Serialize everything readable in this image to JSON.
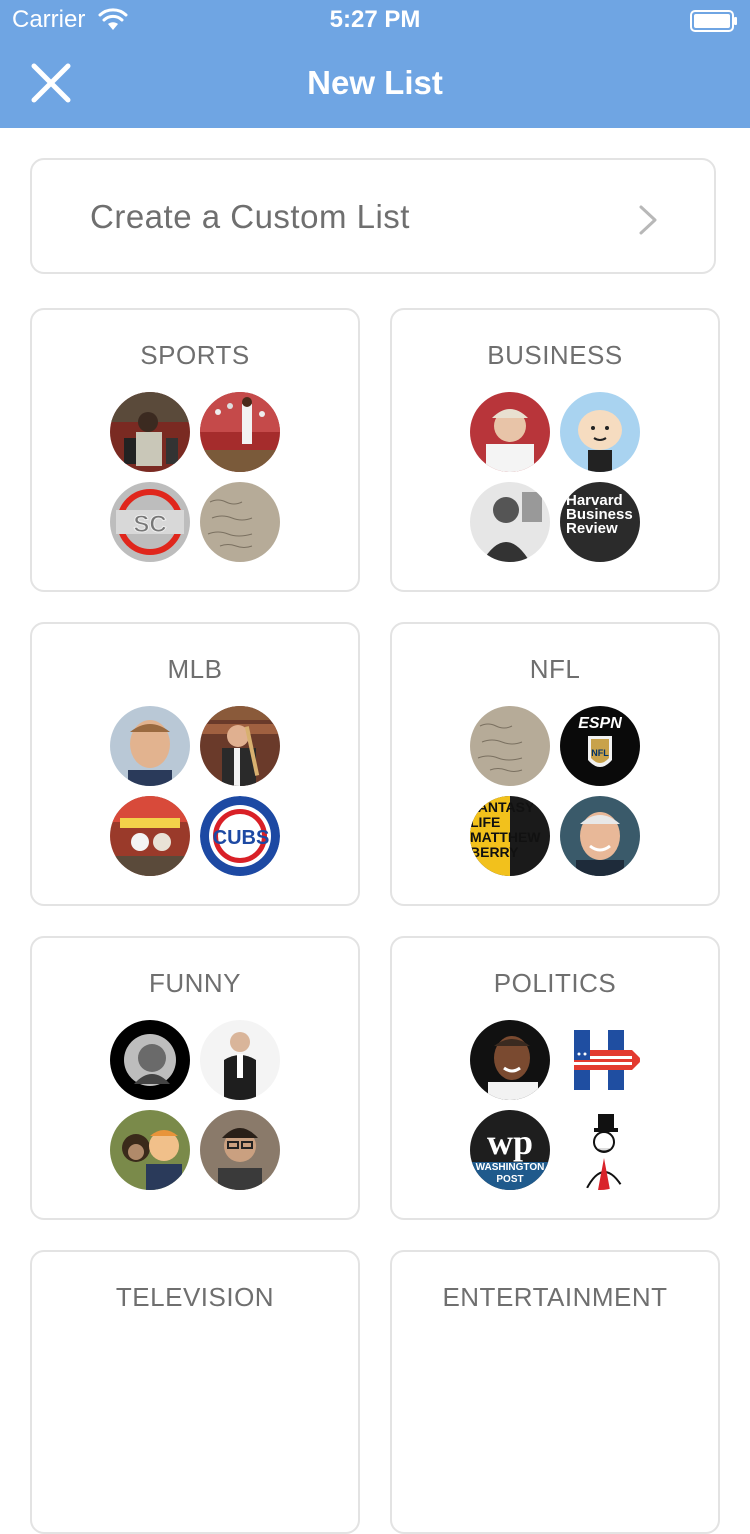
{
  "status_bar": {
    "carrier": "Carrier",
    "time": "5:27 PM"
  },
  "nav": {
    "title": "New List",
    "close_icon": "close-icon"
  },
  "custom_list": {
    "label": "Create a Custom List",
    "chevron_icon": "chevron-right-icon"
  },
  "categories": [
    {
      "title": "SPORTS",
      "avatars": [
        "avatar-player-portrait",
        "avatar-baseball-crowd",
        "avatar-sc-logo",
        "avatar-handwritten-note"
      ]
    },
    {
      "title": "BUSINESS",
      "avatars": [
        "avatar-man-smiling",
        "avatar-cartoon-character",
        "avatar-bw-man",
        "avatar-harvard-business-review"
      ]
    },
    {
      "title": "MLB",
      "avatars": [
        "avatar-man-headshot",
        "avatar-man-bat",
        "avatar-dogs-photo",
        "avatar-cubs-logo"
      ]
    },
    {
      "title": "NFL",
      "avatars": [
        "avatar-handwritten-note",
        "avatar-espn-nfl",
        "avatar-fantasy-life",
        "avatar-coach-smiling"
      ]
    },
    {
      "title": "FUNNY",
      "avatars": [
        "avatar-bw-portrait",
        "avatar-man-suit",
        "avatar-chimp-photo",
        "avatar-man-glasses"
      ]
    },
    {
      "title": "POLITICS",
      "avatars": [
        "avatar-obama",
        "avatar-h-logo",
        "avatar-washington-post",
        "avatar-monopoly-man"
      ]
    },
    {
      "title": "TELEVISION",
      "avatars": []
    },
    {
      "title": "ENTERTAINMENT",
      "avatars": []
    }
  ],
  "avatar_text": {
    "sc": "SC",
    "hbr": "Harvard Business Review",
    "cubs": "CUBS",
    "espn": "ESPN",
    "nfl": "NFL",
    "fantasy": "FANTASY LIFE MATTHEW BERRY",
    "wp_mark": "wp",
    "wp_name": "WASHINGTON POST"
  },
  "colors": {
    "nav_bg": "#6fa5e3",
    "card_border": "#e3e3e3",
    "label_text": "#6f6f6f"
  }
}
